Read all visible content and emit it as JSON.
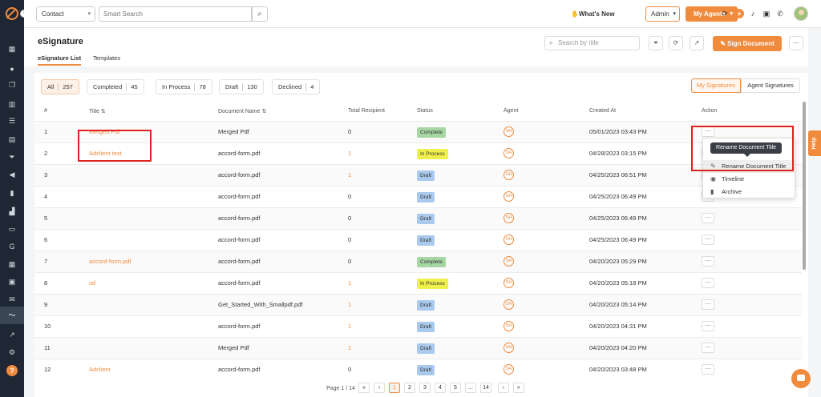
{
  "topbar": {
    "contact_select": "Contact",
    "search_placeholder": "Smart Search",
    "whats_new": "What's New",
    "admin_select": "Admin",
    "my_agents": "My Agents"
  },
  "header": {
    "title": "eSignature",
    "tabs": [
      "eSignature List",
      "Templates"
    ],
    "search_placeholder": "Search by title",
    "sign_button": "Sign Document"
  },
  "filters": [
    {
      "label": "All",
      "count": "257"
    },
    {
      "label": "Completed",
      "count": "45"
    },
    {
      "label": "In Process",
      "count": "78"
    },
    {
      "label": "Draft",
      "count": "130"
    },
    {
      "label": "Declined",
      "count": "4"
    }
  ],
  "signature_toggle": [
    "My Signatures",
    "Agent Signatures"
  ],
  "columns": [
    "#",
    "Title",
    "Document Name",
    "Total Recipient",
    "Status",
    "Agent",
    "Created At",
    "Action"
  ],
  "sort_icon": "⇅",
  "rows": [
    {
      "num": "1",
      "title": "Merged Pdf",
      "doc": "Merged Pdf",
      "recip": "0",
      "status": "Complete",
      "agent": "SH",
      "created": "05/01/2023 03:43 PM"
    },
    {
      "num": "2",
      "title": "Adclient test",
      "doc": "accord-form.pdf",
      "recip": "1",
      "status": "In Process",
      "agent": "SH",
      "created": "04/28/2023 03:15 PM"
    },
    {
      "num": "3",
      "title": "",
      "doc": "accord-form.pdf",
      "recip": "1",
      "status": "Draft",
      "agent": "SH",
      "created": "04/25/2023 06:51 PM"
    },
    {
      "num": "4",
      "title": "",
      "doc": "accord-form.pdf",
      "recip": "0",
      "status": "Draft",
      "agent": "SH",
      "created": "04/25/2023 06:49 PM"
    },
    {
      "num": "5",
      "title": "",
      "doc": "accord-form.pdf",
      "recip": "0",
      "status": "Draft",
      "agent": "SH",
      "created": "04/25/2023 06:49 PM"
    },
    {
      "num": "6",
      "title": "",
      "doc": "accord-form.pdf",
      "recip": "0",
      "status": "Draft",
      "agent": "SH",
      "created": "04/25/2023 06:49 PM"
    },
    {
      "num": "7",
      "title": "accord-form.pdf",
      "doc": "accord-form.pdf",
      "recip": "0",
      "status": "Complete",
      "agent": "SH",
      "created": "04/20/2023 05:29 PM"
    },
    {
      "num": "8",
      "title": "sd",
      "doc": "accord-form.pdf",
      "recip": "1",
      "status": "In Process",
      "agent": "SH",
      "created": "04/20/2023 05:18 PM"
    },
    {
      "num": "9",
      "title": "",
      "doc": "Get_Started_With_Smallpdf.pdf",
      "recip": "1",
      "status": "Draft",
      "agent": "SH",
      "created": "04/20/2023 05:14 PM"
    },
    {
      "num": "10",
      "title": "",
      "doc": "accord-form.pdf",
      "recip": "1",
      "status": "Draft",
      "agent": "SH",
      "created": "04/20/2023 04:31 PM"
    },
    {
      "num": "11",
      "title": "",
      "doc": "Merged Pdf",
      "recip": "1",
      "status": "Draft",
      "agent": "SH",
      "created": "04/20/2023 04:20 PM"
    },
    {
      "num": "12",
      "title": "Adclient",
      "doc": "accord-form.pdf",
      "recip": "0",
      "status": "Draft",
      "agent": "SH",
      "created": "04/20/2023 03:48 PM"
    }
  ],
  "action_menu": {
    "tooltip": "Rename Document Title",
    "items": [
      "Rename Document Title",
      "Timeline",
      "Archive"
    ]
  },
  "pagination": {
    "label": "Page 1 / 14",
    "pages": [
      "«",
      "‹",
      "1",
      "2",
      "3",
      "4",
      "5",
      "...",
      "14",
      "›",
      "»"
    ]
  },
  "help": "Help",
  "colors": {
    "accent": "#f08b3e",
    "sidebar": "#1e2733",
    "complete": "#a6d7a3",
    "process": "#eff04c",
    "draft": "#a9c9ed"
  },
  "icons": [
    "home-icon",
    "contacts-icon",
    "copy-icon",
    "grid-icon",
    "list-icon",
    "book-icon",
    "funnel-icon",
    "megaphone-icon",
    "document-icon",
    "chart-icon",
    "folder-icon",
    "google-icon",
    "calculator-icon",
    "calendar-icon",
    "mail-icon",
    "signature-icon",
    "stats-icon",
    "gear-icon",
    "help-icon"
  ]
}
